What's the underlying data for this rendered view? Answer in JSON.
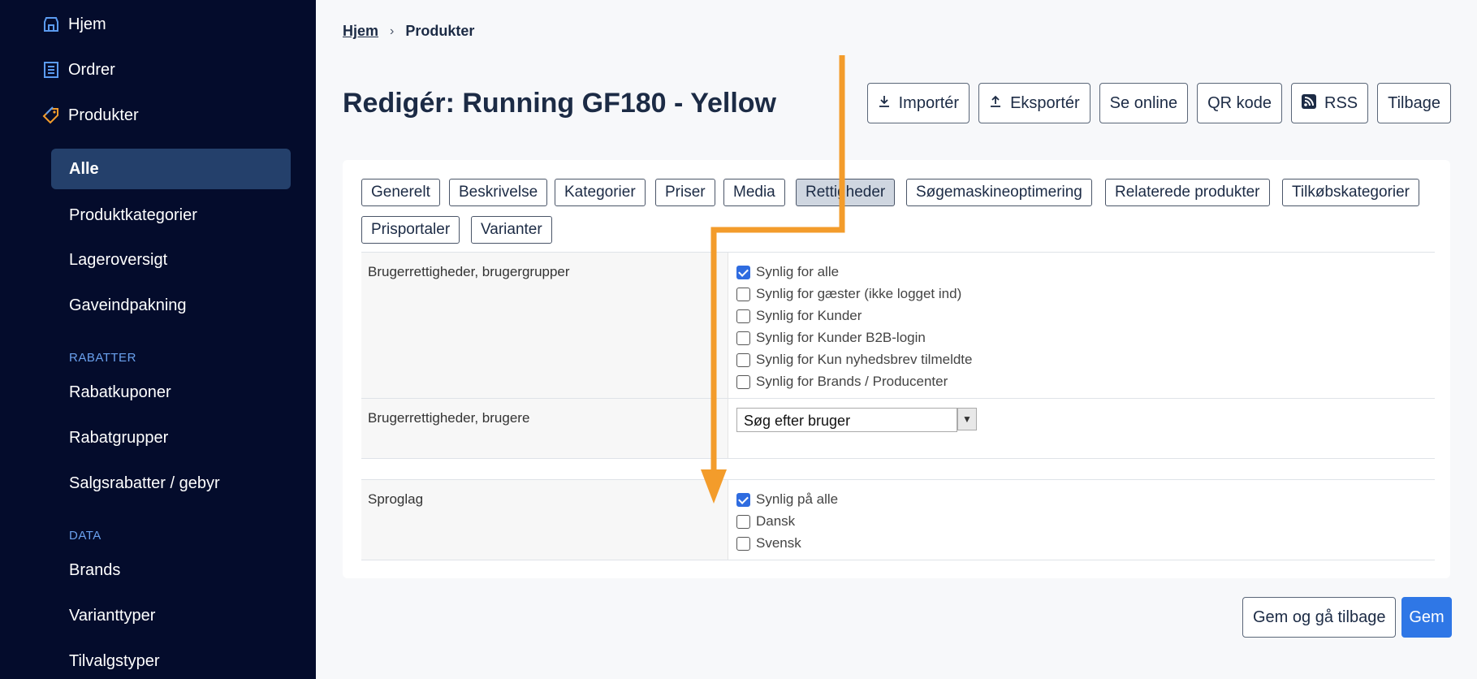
{
  "sidebar": {
    "top_items": [
      {
        "label": "Hjem",
        "icon": "store-icon"
      },
      {
        "label": "Ordrer",
        "icon": "order-list-icon"
      },
      {
        "label": "Produkter",
        "icon": "tag-icon"
      }
    ],
    "products_sub": [
      "Alle",
      "Produktkategorier",
      "Lageroversigt",
      "Gaveindpakning"
    ],
    "section_rabatter": "RABATTER",
    "rabatter_items": [
      "Rabatkuponer",
      "Rabatgrupper",
      "Salgsrabatter / gebyr"
    ],
    "section_data": "DATA",
    "data_items": [
      "Brands",
      "Varianttyper",
      "Tilvalgstyper"
    ]
  },
  "breadcrumb": {
    "home": "Hjem",
    "current": "Produkter"
  },
  "page_title": "Redigér: Running GF180 - Yellow",
  "toolbar": [
    "Importér",
    "Eksportér",
    "Se online",
    "QR kode",
    "RSS",
    "Tilbage"
  ],
  "tabs": [
    "Generelt",
    "Beskrivelse",
    "Kategorier",
    "Priser",
    "Media",
    "Rettigheder",
    "Søgemaskineoptimering",
    "Relaterede produkter",
    "Tilkøbskategorier",
    "Prisportaler",
    "Varianter"
  ],
  "active_tab": "Rettigheder",
  "rows": {
    "groups": {
      "label": "Brugerrettigheder, brugergrupper",
      "options": [
        {
          "label": "Synlig for alle",
          "checked": true
        },
        {
          "label": "Synlig for gæster (ikke logget ind)",
          "checked": false
        },
        {
          "label": "Synlig for Kunder",
          "checked": false
        },
        {
          "label": "Synlig for Kunder B2B-login",
          "checked": false
        },
        {
          "label": "Synlig for Kun nyhedsbrev tilmeldte",
          "checked": false
        },
        {
          "label": "Synlig for Brands / Producenter",
          "checked": false
        }
      ]
    },
    "users": {
      "label": "Brugerrettigheder, brugere",
      "select_value": "Søg efter bruger"
    },
    "languages": {
      "label": "Sproglag",
      "options": [
        {
          "label": "Synlig på alle",
          "checked": true
        },
        {
          "label": "Dansk",
          "checked": false
        },
        {
          "label": "Svensk",
          "checked": false
        }
      ]
    }
  },
  "footer": {
    "save_back": "Gem og gå tilbage",
    "save": "Gem"
  },
  "colors": {
    "sidebar": "#040c2c",
    "active_item": "#24406b",
    "accent": "#2f77e6",
    "arrow": "#f39c2b"
  }
}
